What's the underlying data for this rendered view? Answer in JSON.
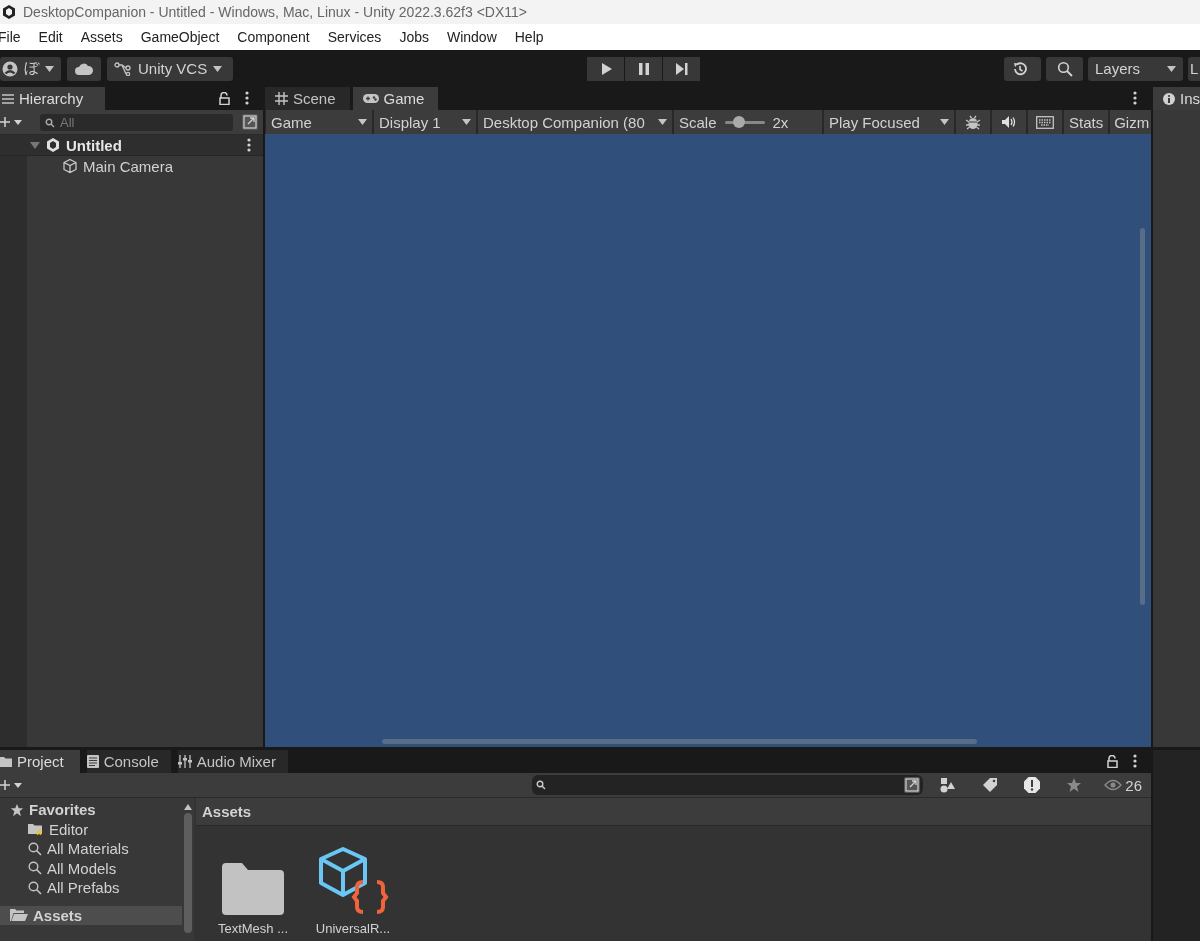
{
  "window": {
    "title": "DesktopCompanion - Untitled - Windows, Mac, Linux - Unity 2022.3.62f3 <DX11>"
  },
  "menu": [
    "File",
    "Edit",
    "Assets",
    "GameObject",
    "Component",
    "Services",
    "Jobs",
    "Window",
    "Help"
  ],
  "toolbar": {
    "account": "ぼ",
    "vcs": "Unity VCS",
    "layers": "Layers",
    "layout": "L"
  },
  "hierarchy": {
    "tab": "Hierarchy",
    "search_placeholder": "All",
    "scene": {
      "name": "Untitled",
      "expanded": true,
      "children": [
        {
          "name": "Main Camera"
        }
      ]
    }
  },
  "view_tabs": [
    {
      "label": "Scene",
      "kind": "scene",
      "selected": false
    },
    {
      "label": "Game",
      "kind": "game",
      "selected": true
    }
  ],
  "game_toolbar": {
    "mode": "Game",
    "display": "Display 1",
    "resolution": "Desktop Companion (80",
    "scale_label": "Scale",
    "scale": {
      "level": 0.35
    },
    "scale_value": "2x",
    "play_mode": "Play Focused",
    "stats": "Stats",
    "gizmos": "Gizm"
  },
  "inspector": {
    "tab": "Ins"
  },
  "bottom_tabs": [
    {
      "label": "Project",
      "kind": "project",
      "selected": true
    },
    {
      "label": "Console",
      "kind": "console",
      "selected": false
    },
    {
      "label": "Audio Mixer",
      "kind": "mixer",
      "selected": false
    }
  ],
  "project": {
    "hidden_count": "26",
    "favorites": {
      "label": "Favorites",
      "items": [
        {
          "label": "Editor",
          "kind": "folder",
          "selected": false
        },
        {
          "label": "All Materials",
          "kind": "search",
          "selected": false
        },
        {
          "label": "All Models",
          "kind": "search",
          "selected": false
        },
        {
          "label": "All Prefabs",
          "kind": "search",
          "selected": false
        }
      ]
    },
    "root": {
      "label": "Assets",
      "selected": true
    },
    "breadcrumb": "Assets",
    "assets": [
      {
        "name": "TextMesh ...",
        "kind": "folder"
      },
      {
        "name": "UniversalR...",
        "kind": "script"
      }
    ]
  }
}
